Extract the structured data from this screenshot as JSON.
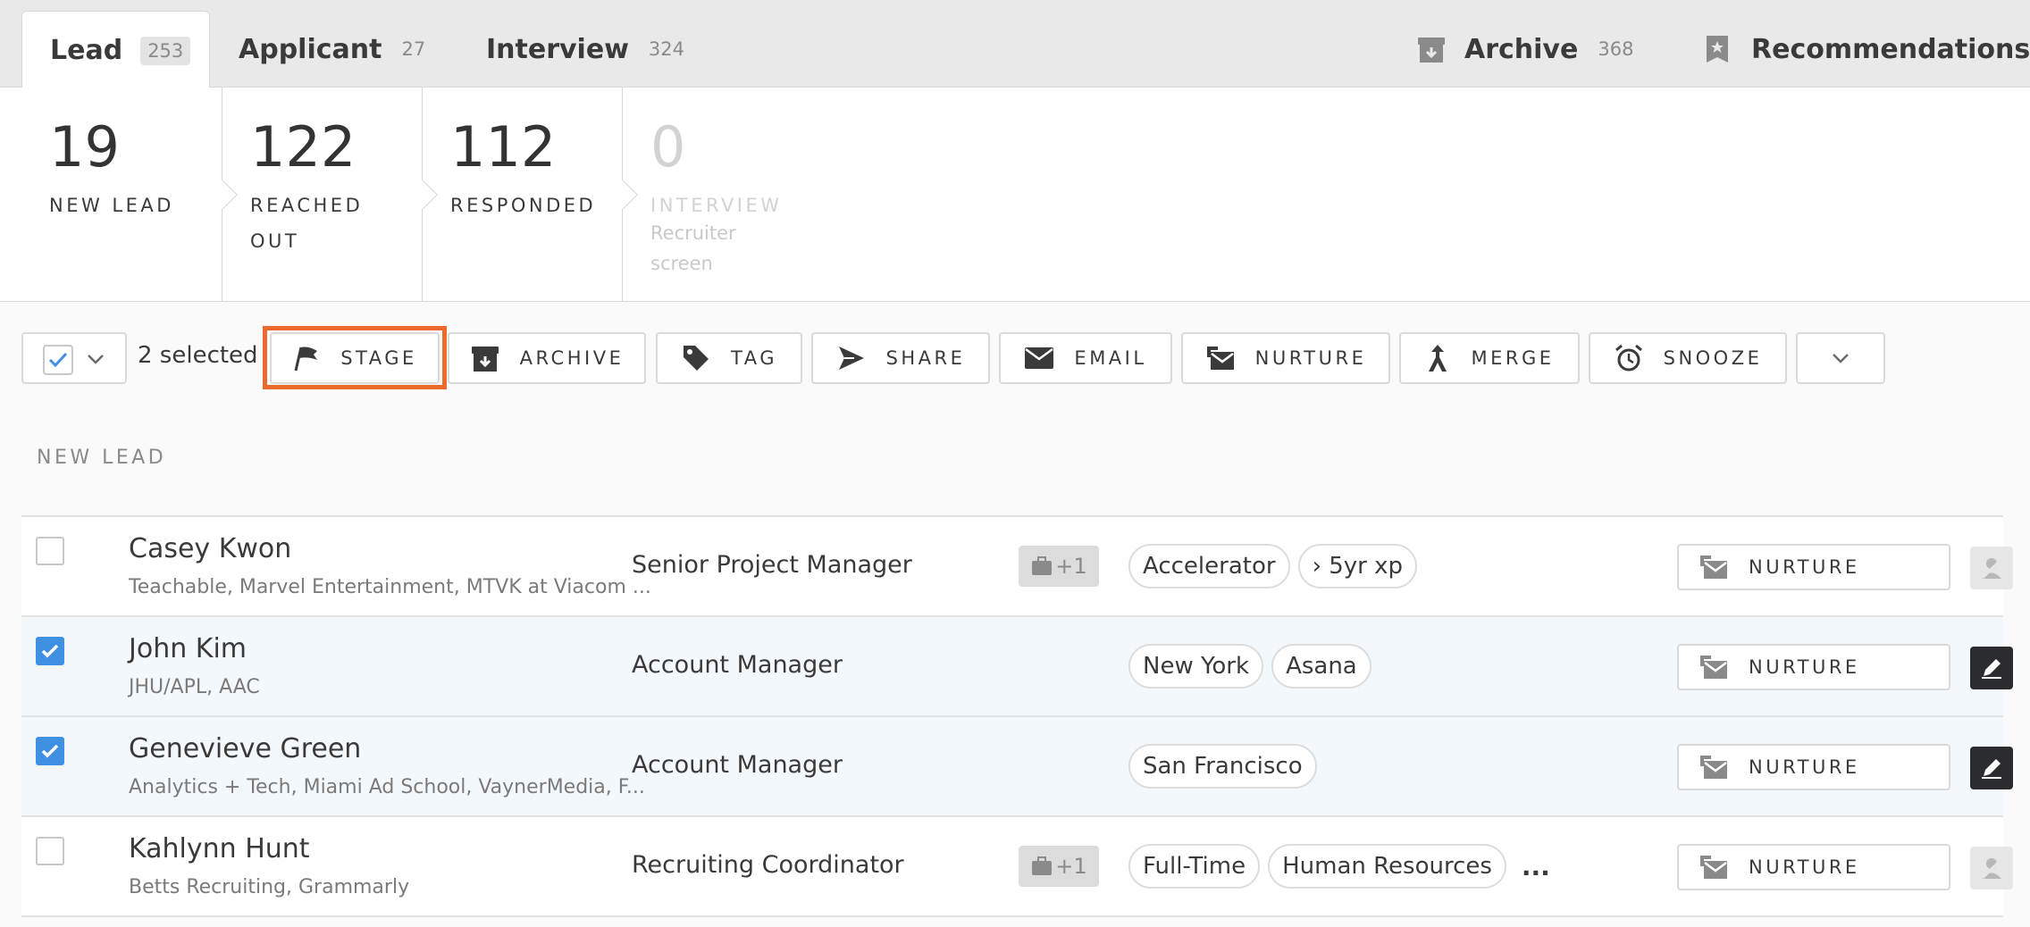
{
  "tabs": [
    {
      "label": "Lead",
      "count": "253"
    },
    {
      "label": "Applicant",
      "count": "27"
    },
    {
      "label": "Interview",
      "count": "324"
    }
  ],
  "right_tabs": {
    "archive": {
      "label": "Archive",
      "count": "368",
      "icon": "archive-box-icon"
    },
    "recommendations": {
      "label": "Recommendations",
      "icon": "star-bookmark-icon"
    }
  },
  "stages": [
    {
      "count": "19",
      "label": "NEW LEAD",
      "label_line2": "",
      "sub_line1": "",
      "sub_line2": ""
    },
    {
      "count": "122",
      "label": "REACHED",
      "label_line2": "OUT",
      "sub_line1": "",
      "sub_line2": ""
    },
    {
      "count": "112",
      "label": "RESPONDED",
      "label_line2": "",
      "sub_line1": "",
      "sub_line2": ""
    },
    {
      "count": "0",
      "label": "INTERVIEW",
      "label_line2": "",
      "sub_line1": "Recruiter",
      "sub_line2": "screen"
    }
  ],
  "toolbar": {
    "selected_text": "2 selected",
    "stage": "STAGE",
    "archive": "ARCHIVE",
    "tag": "TAG",
    "share": "SHARE",
    "email": "EMAIL",
    "nurture": "NURTURE",
    "merge": "MERGE",
    "snooze": "SNOOZE"
  },
  "section_label": "NEW LEAD",
  "rows": [
    {
      "name": "Casey Kwon",
      "companies": "Teachable, Marvel Entertainment, MTVK at Viacom ...",
      "title": "Senior Project Manager",
      "badge": "+1",
      "tags": [
        "Accelerator",
        "› 5yr xp"
      ],
      "more": "",
      "nurture": "NURTURE",
      "checked": false
    },
    {
      "name": "John Kim",
      "companies": "JHU/APL, AAC",
      "title": "Account Manager",
      "badge": "",
      "tags": [
        "New York",
        "Asana"
      ],
      "more": "",
      "nurture": "NURTURE",
      "checked": true
    },
    {
      "name": "Genevieve Green",
      "companies": "Analytics + Tech, Miami Ad School, VaynerMedia, F...",
      "title": "Account Manager",
      "badge": "",
      "tags": [
        "San Francisco"
      ],
      "more": "",
      "nurture": "NURTURE",
      "checked": true
    },
    {
      "name": "Kahlynn Hunt",
      "companies": "Betts Recruiting, Grammarly",
      "title": "Recruiting Coordinator",
      "badge": "+1",
      "tags": [
        "Full-Time",
        "Human Resources"
      ],
      "more": "...",
      "nurture": "NURTURE",
      "checked": false
    }
  ],
  "colors": {
    "accent": "#3f8fe2",
    "highlight": "#ec6a2e"
  }
}
